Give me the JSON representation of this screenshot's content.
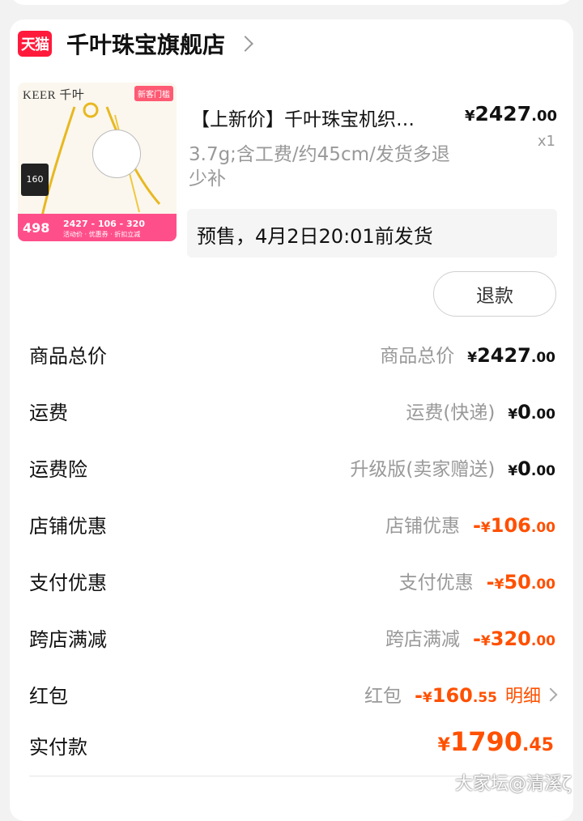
{
  "store": {
    "logo_text": "天猫",
    "name": "千叶珠宝旗舰店"
  },
  "product": {
    "image": {
      "brand": "KEER 千叶",
      "tag": "新客门槛",
      "badge": "160",
      "big_price": "498",
      "price_row": "2427 - 106 - 320",
      "price_row_sub": "活动价 · 优惠券 · 折扣立减"
    },
    "title": "【上新价】千叶珠宝机织…",
    "price_currency": "¥",
    "price_int": "2427",
    "price_dec": ".00",
    "qty": "x1",
    "spec": "3.7g;含工费/约45cm/发货多退少补",
    "presale": "预售，4月2日20:01前发货",
    "refund_button": "退款"
  },
  "summary": [
    {
      "label": "商品总价",
      "desc": "商品总价",
      "sign": "",
      "int": "2427",
      "dec": ".00",
      "red": false
    },
    {
      "label": "运费",
      "desc": "运费(快递)",
      "sign": "",
      "int": "0",
      "dec": ".00",
      "red": false
    },
    {
      "label": "运费险",
      "desc": "升级版(卖家赠送)",
      "sign": "",
      "int": "0",
      "dec": ".00",
      "red": false
    },
    {
      "label": "店铺优惠",
      "desc": "店铺优惠",
      "sign": "-",
      "int": "106",
      "dec": ".00",
      "red": true
    },
    {
      "label": "支付优惠",
      "desc": "支付优惠",
      "sign": "-",
      "int": "50",
      "dec": ".00",
      "red": true
    },
    {
      "label": "跨店满减",
      "desc": "跨店满减",
      "sign": "-",
      "int": "320",
      "dec": ".00",
      "red": true
    },
    {
      "label": "红包",
      "desc": "红包",
      "sign": "-",
      "int": "160",
      "dec": ".55",
      "red": true,
      "link": "明细"
    }
  ],
  "total": {
    "label": "实付款",
    "int": "1790",
    "dec": ".45"
  },
  "currency_symbol": "¥",
  "watermark": "大家坛@清溪ζ",
  "colors": {
    "accent": "#ff5000",
    "tmall_red": "#ff1a3b"
  }
}
